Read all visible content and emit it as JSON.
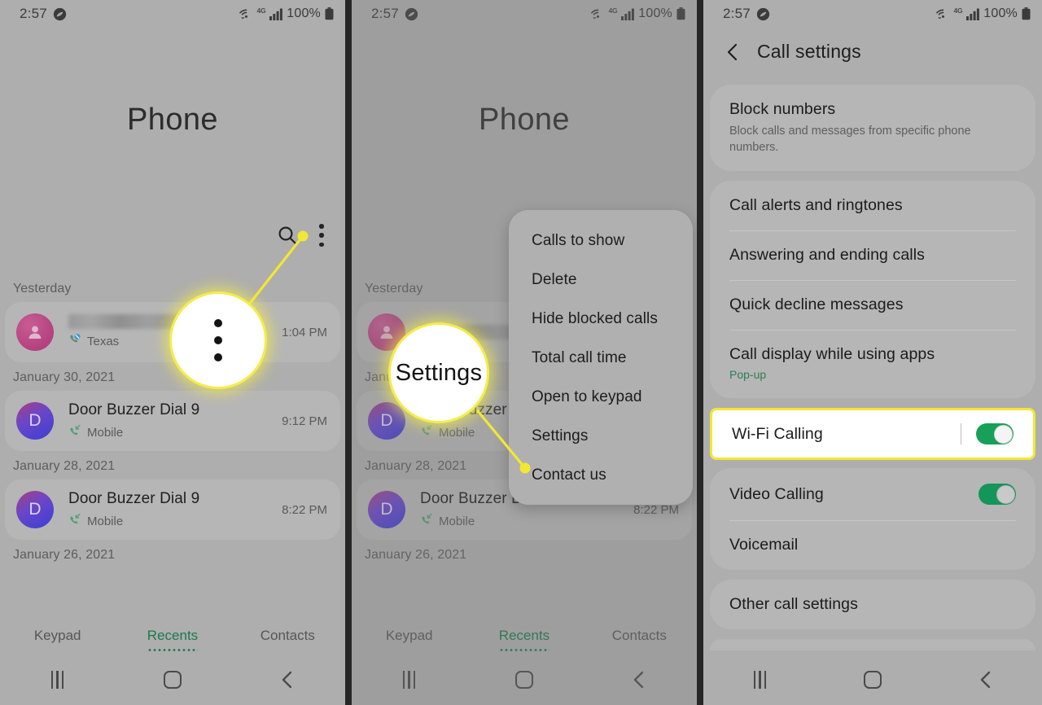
{
  "statusbar": {
    "time": "2:57",
    "app_icon": "shazam-icon",
    "wifi_icon": "wifi-icon",
    "network_label": "4G",
    "signal_icon": "signal-bars-icon",
    "battery_percent": "100%",
    "battery_icon": "battery-full-icon"
  },
  "panel1": {
    "app_title": "Phone",
    "search_icon": "search-icon",
    "overflow_icon": "overflow-menu-icon",
    "callout": {
      "type": "overflow-dots",
      "label": ""
    },
    "groups": [
      {
        "date": "Yesterday",
        "calls": [
          {
            "avatar_letter": "",
            "avatar_style": "pink",
            "name": "",
            "redacted": true,
            "sub_icon": "blocked-call-icon",
            "sub": "Texas",
            "time": "1:04 PM"
          }
        ]
      },
      {
        "date": "January 30, 2021",
        "calls": [
          {
            "avatar_letter": "D",
            "avatar_style": "blue",
            "name": "Door Buzzer Dial 9",
            "redacted": false,
            "sub_icon": "incoming-call-icon",
            "sub": "Mobile",
            "time": "9:12 PM"
          }
        ]
      },
      {
        "date": "January 28, 2021",
        "calls": [
          {
            "avatar_letter": "D",
            "avatar_style": "blue",
            "name": "Door Buzzer Dial 9",
            "redacted": false,
            "sub_icon": "incoming-call-icon",
            "sub": "Mobile",
            "time": "8:22 PM"
          }
        ]
      },
      {
        "date": "January 26, 2021",
        "calls": []
      }
    ],
    "tabs": [
      {
        "label": "Keypad",
        "active": false
      },
      {
        "label": "Recents",
        "active": true
      },
      {
        "label": "Contacts",
        "active": false
      }
    ]
  },
  "panel2": {
    "app_title": "Phone",
    "callout": {
      "type": "text",
      "label": "Settings"
    },
    "menu": {
      "items": [
        "Calls to show",
        "Delete",
        "Hide blocked calls",
        "Total call time",
        "Open to keypad",
        "Settings",
        "Contact us"
      ]
    },
    "groups": [
      {
        "date": "Yesterday",
        "calls": [
          {
            "avatar_letter": "",
            "avatar_style": "pink",
            "name": "",
            "redacted": true,
            "sub_icon": "blocked-call-icon",
            "sub": "",
            "time": ""
          }
        ]
      },
      {
        "date": "January 30, 2021",
        "calls": [
          {
            "avatar_letter": "D",
            "avatar_style": "blue",
            "name": "Door Buzzer Dial 9",
            "redacted": false,
            "sub_icon": "incoming-call-icon",
            "sub": "Mobile",
            "time": ""
          }
        ]
      },
      {
        "date": "January 28, 2021",
        "calls": [
          {
            "avatar_letter": "D",
            "avatar_style": "blue",
            "name": "Door Buzzer Dial 9",
            "redacted": false,
            "sub_icon": "incoming-call-icon",
            "sub": "Mobile",
            "time": "8:22 PM"
          }
        ]
      },
      {
        "date": "January 26, 2021",
        "calls": []
      }
    ],
    "tabs": [
      {
        "label": "Keypad",
        "active": false
      },
      {
        "label": "Recents",
        "active": true
      },
      {
        "label": "Contacts",
        "active": false
      }
    ]
  },
  "panel3": {
    "back_icon": "back-chevron-icon",
    "title": "Call settings",
    "cards": [
      {
        "rows": [
          {
            "title": "Block numbers",
            "sub": "Block calls and messages from specific phone numbers.",
            "sub_green": false,
            "toggle": null
          }
        ]
      },
      {
        "rows": [
          {
            "title": "Call alerts and ringtones",
            "sub": "",
            "sub_green": false,
            "toggle": null
          },
          {
            "title": "Answering and ending calls",
            "sub": "",
            "sub_green": false,
            "toggle": null
          },
          {
            "title": "Quick decline messages",
            "sub": "",
            "sub_green": false,
            "toggle": null
          },
          {
            "title": "Call display while using apps",
            "sub": "Pop-up",
            "sub_green": true,
            "toggle": null
          }
        ]
      },
      {
        "highlight": true,
        "rows": [
          {
            "title": "Wi-Fi Calling",
            "sub": "",
            "sub_green": false,
            "toggle": "on",
            "divider": true
          }
        ]
      },
      {
        "rows": [
          {
            "title": "Video Calling",
            "sub": "",
            "sub_green": false,
            "toggle": "on"
          },
          {
            "title": "Voicemail",
            "sub": "",
            "sub_green": false,
            "toggle": null
          }
        ]
      },
      {
        "rows": [
          {
            "title": "Other call settings",
            "sub": "",
            "sub_green": false,
            "toggle": null
          }
        ]
      }
    ]
  },
  "colors": {
    "highlight_yellow": "#f2e733",
    "toggle_green": "#18a058",
    "accent_green": "#1a7a4a",
    "panel_bg": "#aeaeae",
    "card_bg": "#b6b6b6"
  },
  "navbar": {
    "recents_icon": "recent-apps-icon",
    "home_icon": "home-icon",
    "back_icon": "back-icon"
  }
}
